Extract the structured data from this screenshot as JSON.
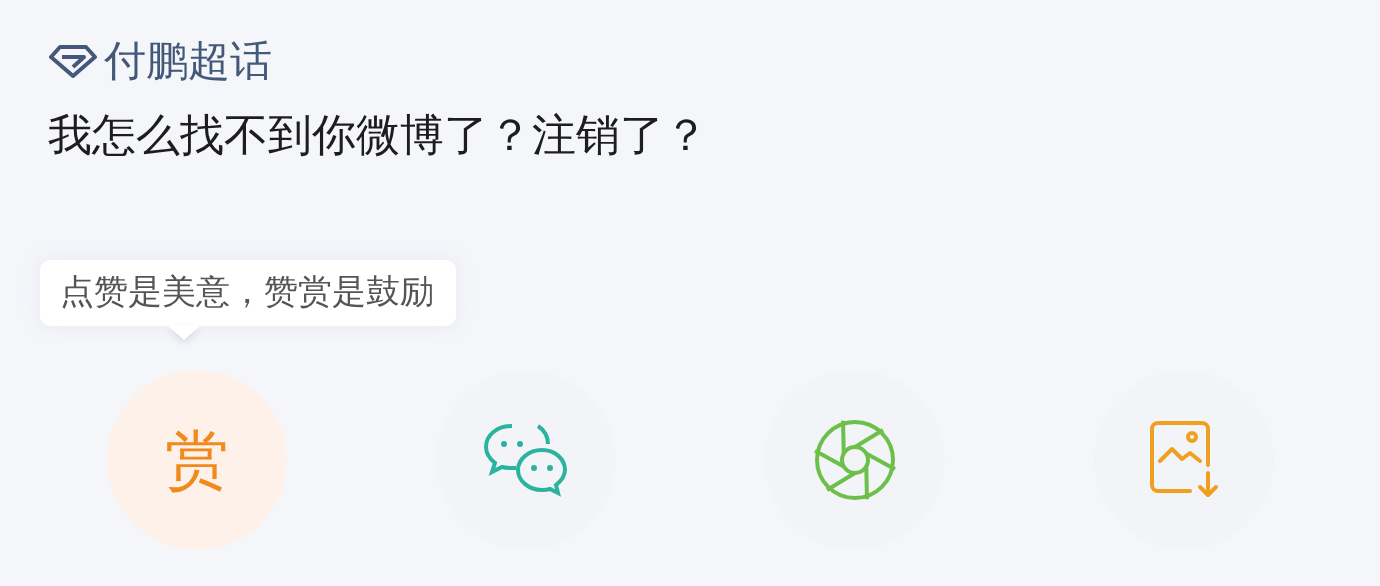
{
  "topic": {
    "label": "付鹏超话"
  },
  "post": {
    "text": "我怎么找不到你微博了？注销了？"
  },
  "tooltip": {
    "text": "点赞是美意，赞赏是鼓励"
  },
  "share_actions": [
    {
      "kind": "reward",
      "label": "赏"
    },
    {
      "kind": "wechat"
    },
    {
      "kind": "moments"
    },
    {
      "kind": "save-image"
    }
  ]
}
